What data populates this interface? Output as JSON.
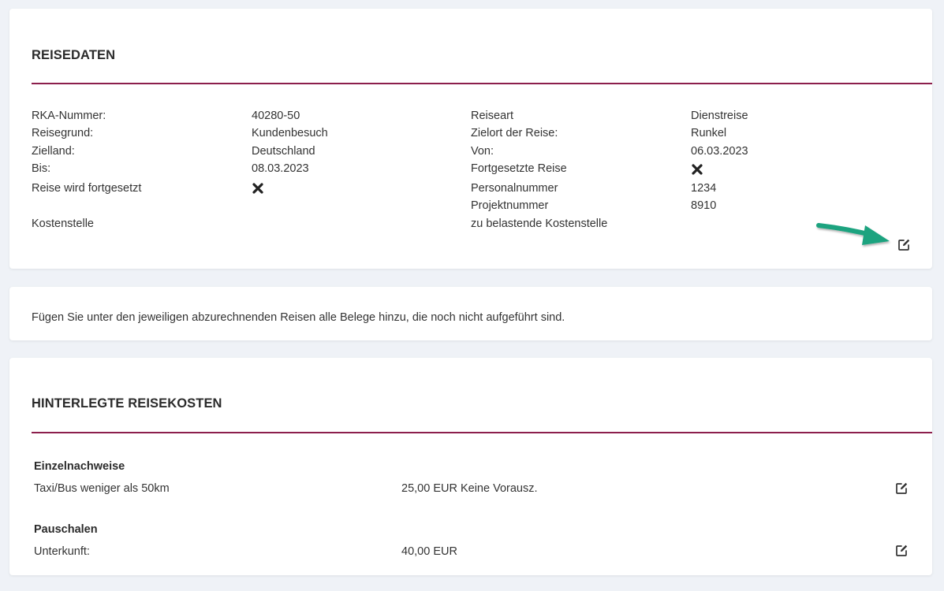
{
  "reisedaten": {
    "title": "REISEDATEN",
    "left": [
      {
        "label": "RKA-Nummer:",
        "value": "40280-50"
      },
      {
        "label": "Reisegrund:",
        "value": "Kundenbesuch"
      },
      {
        "label": "Zielland:",
        "value": "Deutschland"
      },
      {
        "label": "Bis:",
        "value": "08.03.2023"
      },
      {
        "label": "Reise wird fortgesetzt",
        "icon": "x-mark-icon"
      },
      {
        "label": "Kostenstelle",
        "value": ""
      }
    ],
    "right": [
      {
        "label": "Reiseart",
        "value": "Dienstreise"
      },
      {
        "label": "Zielort der Reise:",
        "value": "Runkel"
      },
      {
        "label": "Von:",
        "value": "06.03.2023"
      },
      {
        "label": "Fortgesetzte Reise",
        "icon": "x-mark-icon"
      },
      {
        "label": "Personalnummer",
        "value": "1234"
      },
      {
        "label": "Projektnummer",
        "value": "8910"
      },
      {
        "label": "zu belastende Kostenstelle",
        "value": ""
      }
    ],
    "edit_icon": "edit-icon"
  },
  "info": {
    "text": "Fügen Sie unter den jeweiligen abzurechnenden Reisen alle Belege hinzu, die noch nicht aufgeführt sind."
  },
  "reisekosten": {
    "title": "HINTERLEGTE REISEKOSTEN",
    "groups": [
      {
        "heading": "Einzelnachweise",
        "rows": [
          {
            "label": "Taxi/Bus weniger als 50km",
            "value": "25,00 EUR Keine Vorausz.",
            "icon": "edit-icon"
          }
        ]
      },
      {
        "heading": "Pauschalen",
        "rows": [
          {
            "label": "Unterkunft:",
            "value": "40,00 EUR",
            "icon": "edit-icon"
          }
        ]
      }
    ]
  },
  "colors": {
    "accent_rule": "#8c1f4c",
    "annotation_arrow": "#1aa37f",
    "background": "#eff2f7"
  }
}
